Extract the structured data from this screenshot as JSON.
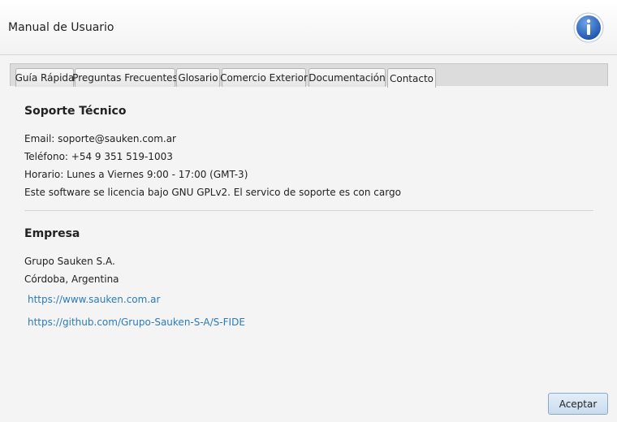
{
  "window": {
    "title": "Manual de Usuario"
  },
  "tabs": [
    {
      "label": "Guía Rápida"
    },
    {
      "label": "Preguntas Frecuentes"
    },
    {
      "label": "Glosario"
    },
    {
      "label": "Comercio Exterior"
    },
    {
      "label": "Documentación"
    },
    {
      "label": "Contacto",
      "active": true
    }
  ],
  "support": {
    "title": "Soporte Técnico",
    "email": "Email: soporte@sauken.com.ar",
    "phone": "Teléfono: +54 9 351 519-1003",
    "hours": "Horario: Lunes a Viernes 9:00 - 17:00 (GMT-3)",
    "license": "Este software se licencia bajo GNU GPLv2. El servico de soporte es con cargo"
  },
  "company": {
    "title": "Empresa",
    "name": "Grupo Sauken S.A.",
    "location": "Córdoba, Argentina",
    "website": "https://www.sauken.com.ar",
    "github": "https://github.com/Grupo-Sauken-S-A/S-FIDE"
  },
  "footer": {
    "accept_label": "Aceptar"
  },
  "icons": {
    "header_icon": "info-icon"
  },
  "colors": {
    "link": "#2a7bb8",
    "info_icon": "#2f6fc8"
  }
}
